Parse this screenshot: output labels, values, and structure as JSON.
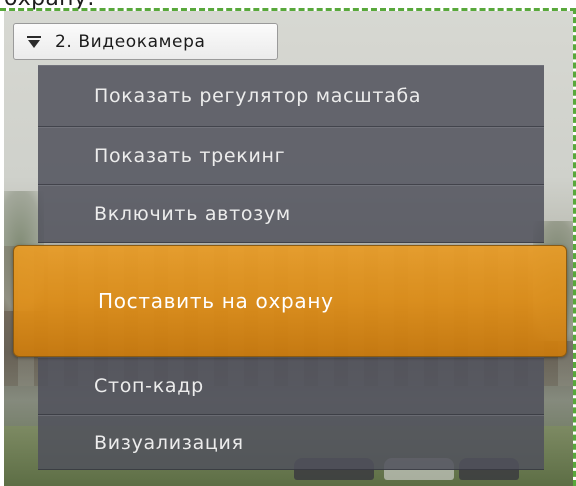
{
  "doc": {
    "top_text": "охрану:"
  },
  "camera": {
    "title": "2. Видеокамера",
    "menu_icon": "triangle-down-icon"
  },
  "menu": {
    "items": [
      {
        "label": "Показать регулятор масштаба"
      },
      {
        "label": "Показать трекинг"
      },
      {
        "label": "Включить автозум"
      },
      {
        "label": "Поставить на охрану",
        "highlighted": true
      },
      {
        "label": "Стоп-кадр"
      },
      {
        "label": "Визуализация"
      }
    ]
  },
  "colors": {
    "menu_bg": "#50525c",
    "highlight": "#e39a26",
    "frame_border": "#58a83b",
    "menu_text": "#ececec"
  }
}
